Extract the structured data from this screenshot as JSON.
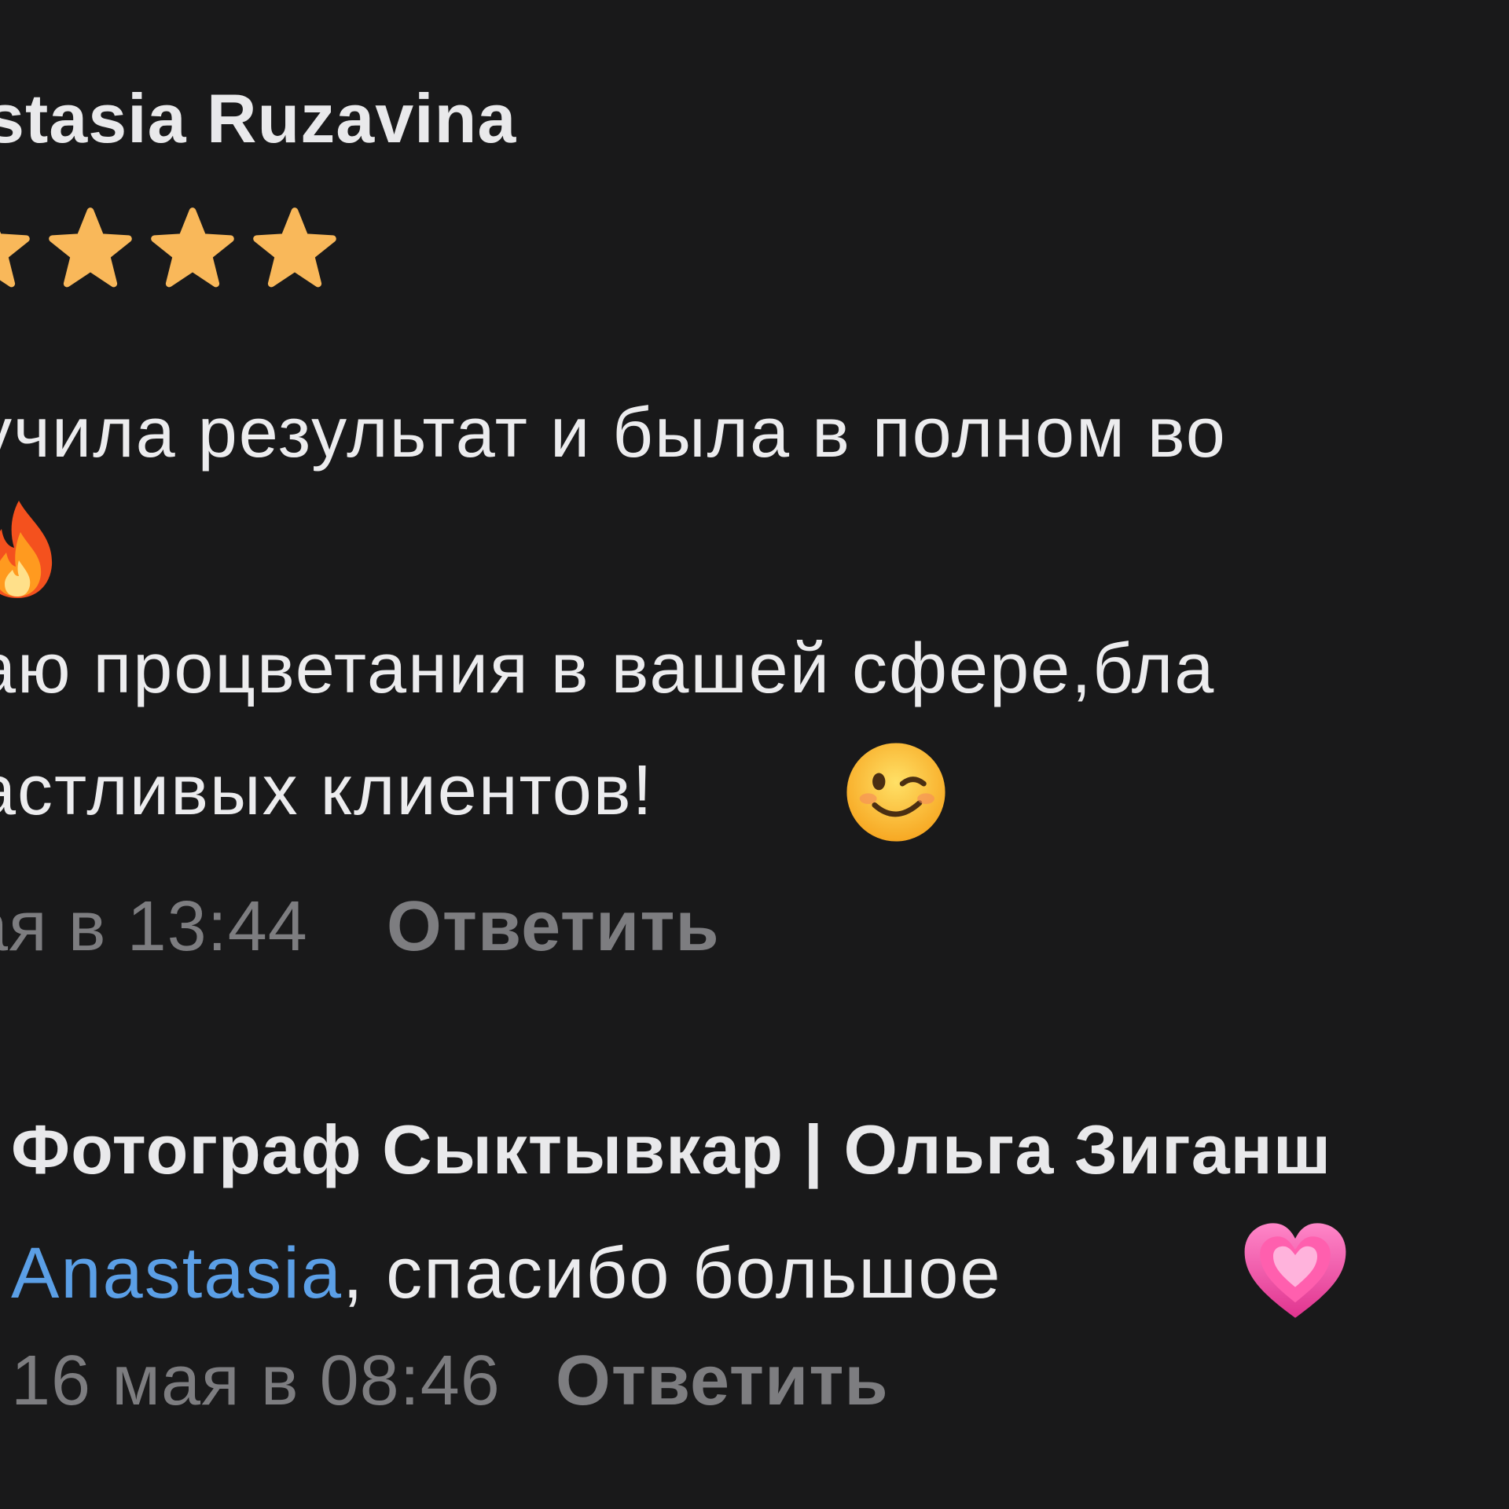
{
  "comment1": {
    "author": "stasia Ruzavina",
    "rating": {
      "stars_visible": 4,
      "star_color": "#f9b85a",
      "icon": "star-icon"
    },
    "text_lines": [
      "учила результат и была в полном во",
      "",
      "аю процветания в вашей сфере,бла",
      "астливых клиентов!"
    ],
    "emojis": [
      "fire-emoji",
      "winking-face-emoji"
    ],
    "timestamp": "ая в 13:44",
    "reply_label": "Ответить"
  },
  "comment2": {
    "author": "Фотограф Сыктывкар | Ольга Зиганш",
    "mention": "Anastasia",
    "text": ", спасибо большое ",
    "emoji": "growing-heart-emoji",
    "timestamp": "16 мая в 08:46",
    "reply_label": "Ответить"
  },
  "colors": {
    "background": "#19191a",
    "text": "#ececee",
    "meta": "#7d7d80",
    "mention": "#5b9fe6",
    "star": "#f9b85a"
  }
}
